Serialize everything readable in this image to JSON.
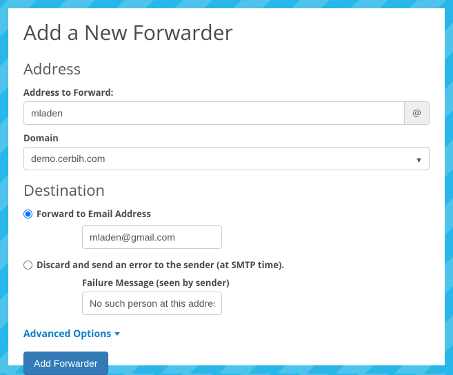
{
  "title": "Add a New Forwarder",
  "addressSection": {
    "heading": "Address",
    "addressLabel": "Address to Forward:",
    "addressValue": "mladen",
    "atSymbol": "@",
    "domainLabel": "Domain",
    "domainValue": "demo.cerbih.com"
  },
  "destinationSection": {
    "heading": "Destination",
    "forwardOption": {
      "label": "Forward to Email Address",
      "value": "mladen@gmail.com",
      "selected": true
    },
    "discardOption": {
      "label": "Discard and send an error to the sender (at SMTP time).",
      "failureLabel": "Failure Message (seen by sender)",
      "failureValue": "No such person at this address.",
      "selected": false
    }
  },
  "advancedLabel": "Advanced Options",
  "submitLabel": "Add Forwarder"
}
